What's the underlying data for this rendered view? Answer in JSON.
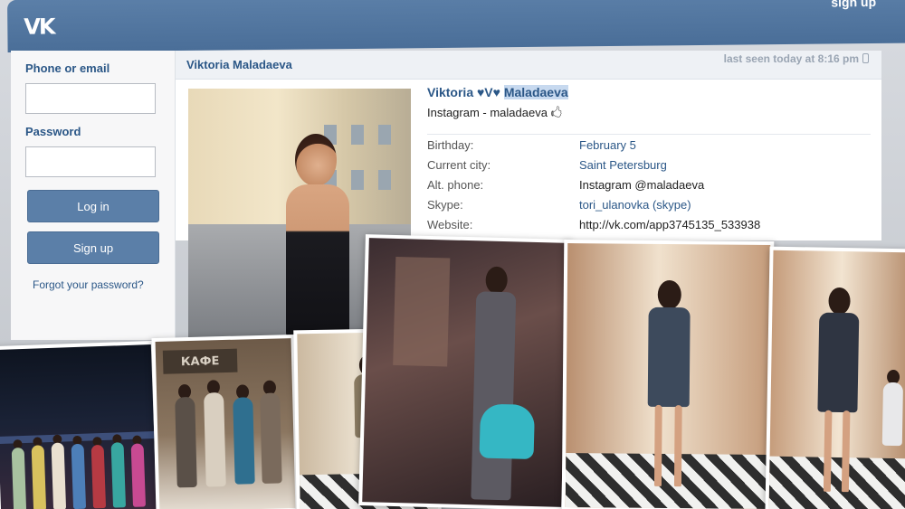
{
  "header": {
    "logo_text": "VK",
    "signup_link": "sign up"
  },
  "login": {
    "phone_label": "Phone or email",
    "password_label": "Password",
    "login_button": "Log in",
    "signup_button": "Sign up",
    "forgot_link": "Forgot your password?"
  },
  "profile": {
    "name_bar": "Viktoria Maladaeva",
    "last_seen": "last seen today at 8:16 pm",
    "full_name_prefix": "Viktoria ♥V♥ ",
    "full_name_highlight": "Maladaeva",
    "status": "Instagram - maladaeva 🖒",
    "fields": [
      {
        "label": "Birthday:",
        "value": "February 5"
      },
      {
        "label": "Current city:",
        "value": "Saint Petersburg"
      },
      {
        "label": "Alt. phone:",
        "value": "Instagram @maladaeva"
      },
      {
        "label": "Skype:",
        "value": "tori_ulanovka (skype)"
      },
      {
        "label": "Website:",
        "value": "http://vk.com/app3745135_533938"
      }
    ]
  },
  "photos": {
    "cafe_sign": "КАФЕ"
  },
  "colors": {
    "brand": "#5b7fa8",
    "link": "#2b5787"
  }
}
